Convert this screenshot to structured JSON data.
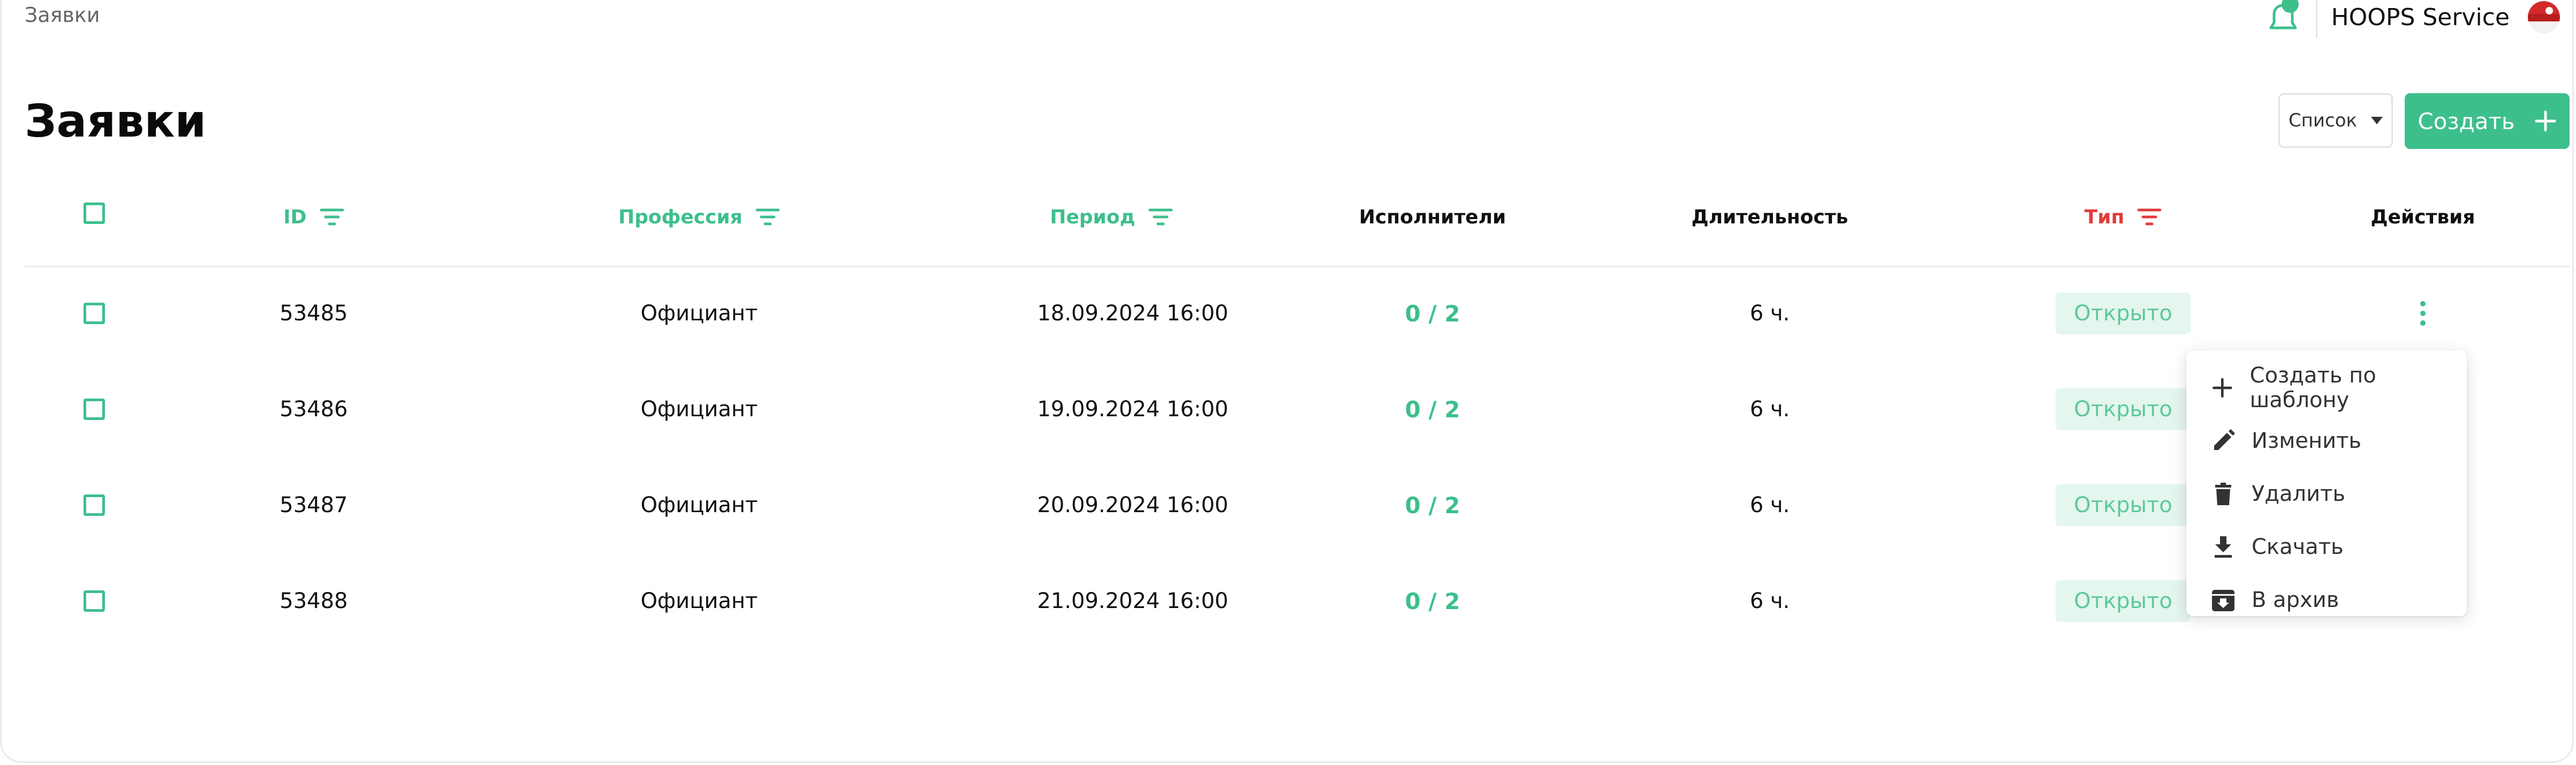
{
  "breadcrumb": "Заявки",
  "header": {
    "company": "HOOPS Service"
  },
  "page": {
    "title": "Заявки"
  },
  "toolbar": {
    "view_label": "Список",
    "create_label": "Создать"
  },
  "table": {
    "columns": {
      "id": "ID",
      "profession": "Профессия",
      "period": "Период",
      "executors": "Исполнители",
      "duration": "Длительность",
      "type": "Тип",
      "actions": "Действия"
    },
    "rows": [
      {
        "id": "53485",
        "profession": "Официант",
        "period": "18.09.2024 16:00",
        "executors": "0 / 2",
        "duration": "6 ч.",
        "type": "Открыто"
      },
      {
        "id": "53486",
        "profession": "Официант",
        "period": "19.09.2024 16:00",
        "executors": "0 / 2",
        "duration": "6 ч.",
        "type": "Открыто"
      },
      {
        "id": "53487",
        "profession": "Официант",
        "period": "20.09.2024 16:00",
        "executors": "0 / 2",
        "duration": "6 ч.",
        "type": "Открыто"
      },
      {
        "id": "53488",
        "profession": "Официант",
        "period": "21.09.2024 16:00",
        "executors": "0 / 2",
        "duration": "6 ч.",
        "type": "Открыто"
      }
    ]
  },
  "actions_menu": {
    "items": [
      {
        "label": "Создать по шаблону",
        "icon": "plus-icon"
      },
      {
        "label": "Изменить",
        "icon": "pencil-icon"
      },
      {
        "label": "Удалить",
        "icon": "trash-icon"
      },
      {
        "label": "Скачать",
        "icon": "download-icon"
      },
      {
        "label": "В архив",
        "icon": "archive-icon"
      }
    ]
  },
  "colors": {
    "accent": "#3dbf8c",
    "filter_active": "#e23b3b",
    "status_bg": "#e4f6ee"
  }
}
